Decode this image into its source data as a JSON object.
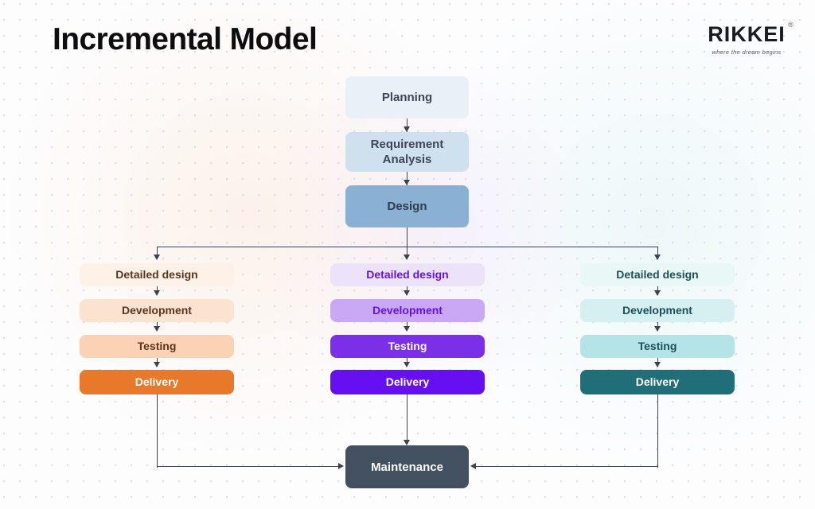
{
  "page": {
    "title": "Incremental Model",
    "background_color": "#fbfbfd",
    "connector_color": "#3d4250"
  },
  "logo": {
    "mark": "RIKKEI",
    "registered": "®",
    "tagline": "where the dream begins"
  },
  "diagram": {
    "type": "flowchart",
    "stages": {
      "planning": {
        "label": "Planning",
        "fill": "#eaf0f8",
        "text_color": "#3d4758"
      },
      "requirement_analysis": {
        "label": "Requirement\nAnalysis",
        "fill": "#cfe0ef",
        "text_color": "#3d4758"
      },
      "design": {
        "label": "Design",
        "fill": "#8ab0d4",
        "text_color": "#2f3c4c"
      },
      "maintenance": {
        "label": "Maintenance",
        "fill": "#42505f",
        "text_color": "#ffffff"
      }
    },
    "increments": [
      {
        "name": "increment-1",
        "accent": "#e8792b",
        "steps": [
          {
            "label": "Detailed design",
            "fill": "#fdf1e8",
            "text_color": "#5a3520"
          },
          {
            "label": "Development",
            "fill": "#fbe3d2",
            "text_color": "#5a3520"
          },
          {
            "label": "Testing",
            "fill": "#fbd2b4",
            "text_color": "#5a3520"
          },
          {
            "label": "Delivery",
            "fill": "#e8792b",
            "text_color": "#ffffff"
          }
        ]
      },
      {
        "name": "increment-2",
        "accent": "#6610f2",
        "steps": [
          {
            "label": "Detailed design",
            "fill": "#ece2fa",
            "text_color": "#6610f2"
          },
          {
            "label": "Development",
            "fill": "#c9a8f5",
            "text_color": "#6610f2"
          },
          {
            "label": "Testing",
            "fill": "#7b30e8",
            "text_color": "#ffffff"
          },
          {
            "label": "Delivery",
            "fill": "#6610f2",
            "text_color": "#ffffff"
          }
        ]
      },
      {
        "name": "increment-3",
        "accent": "#1f6e78",
        "steps": [
          {
            "label": "Detailed design",
            "fill": "#eaf7f7",
            "text_color": "#1c4f56"
          },
          {
            "label": "Development",
            "fill": "#d6f0f2",
            "text_color": "#1c4f56"
          },
          {
            "label": "Testing",
            "fill": "#b5e4e8",
            "text_color": "#1c4f56"
          },
          {
            "label": "Delivery",
            "fill": "#1f6e78",
            "text_color": "#ffffff"
          }
        ]
      }
    ]
  }
}
